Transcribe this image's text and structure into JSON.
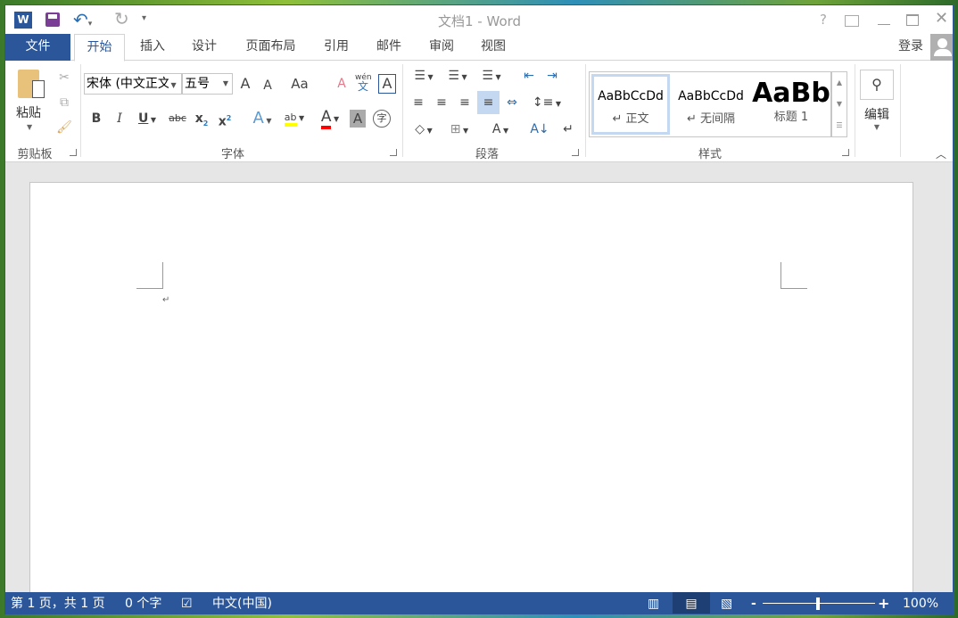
{
  "title_bar": {
    "title": "文档1 - Word",
    "help": "?",
    "qat_more": "▾"
  },
  "tabs": [
    {
      "label": "文件"
    },
    {
      "label": "开始"
    },
    {
      "label": "插入"
    },
    {
      "label": "设计"
    },
    {
      "label": "页面布局"
    },
    {
      "label": "引用"
    },
    {
      "label": "邮件"
    },
    {
      "label": "审阅"
    },
    {
      "label": "视图"
    }
  ],
  "account": {
    "signin": "登录"
  },
  "ribbon": {
    "clipboard": {
      "paste": "粘贴",
      "label": "剪贴板"
    },
    "font": {
      "name": "宋体 (中文正文",
      "size": "五号",
      "label": "字体",
      "grow": "A",
      "shrink": "A",
      "case": "Aa",
      "phonetic_top": "wén",
      "phonetic": "文",
      "border_char": "A",
      "bold": "B",
      "italic": "I",
      "underline": "U",
      "strike": "abc",
      "sub": "x",
      "sup": "x",
      "effects": "A",
      "highlight": "ab",
      "color": "A",
      "shading": "A",
      "enclose": "字"
    },
    "paragraph": {
      "label": "段落"
    },
    "styles": {
      "label": "样式",
      "items": [
        {
          "preview": "AaBbCcDd",
          "name": "↵ 正文"
        },
        {
          "preview": "AaBbCcDd",
          "name": "↵ 无间隔"
        },
        {
          "preview": "AaBb",
          "name": "标题 1"
        }
      ]
    },
    "editing": {
      "label": "编辑"
    }
  },
  "document": {
    "paragraph_mark": "↵"
  },
  "status": {
    "page": "第 1 页，共 1 页",
    "words": "0 个字",
    "language": "中文(中国)",
    "zoom": "100%",
    "zoom_minus": "-",
    "zoom_plus": "+",
    "zoom_percent": 100
  },
  "colors": {
    "accent": "#2b579a",
    "highlight": "#ffff00",
    "font_color": "#ff0000"
  }
}
